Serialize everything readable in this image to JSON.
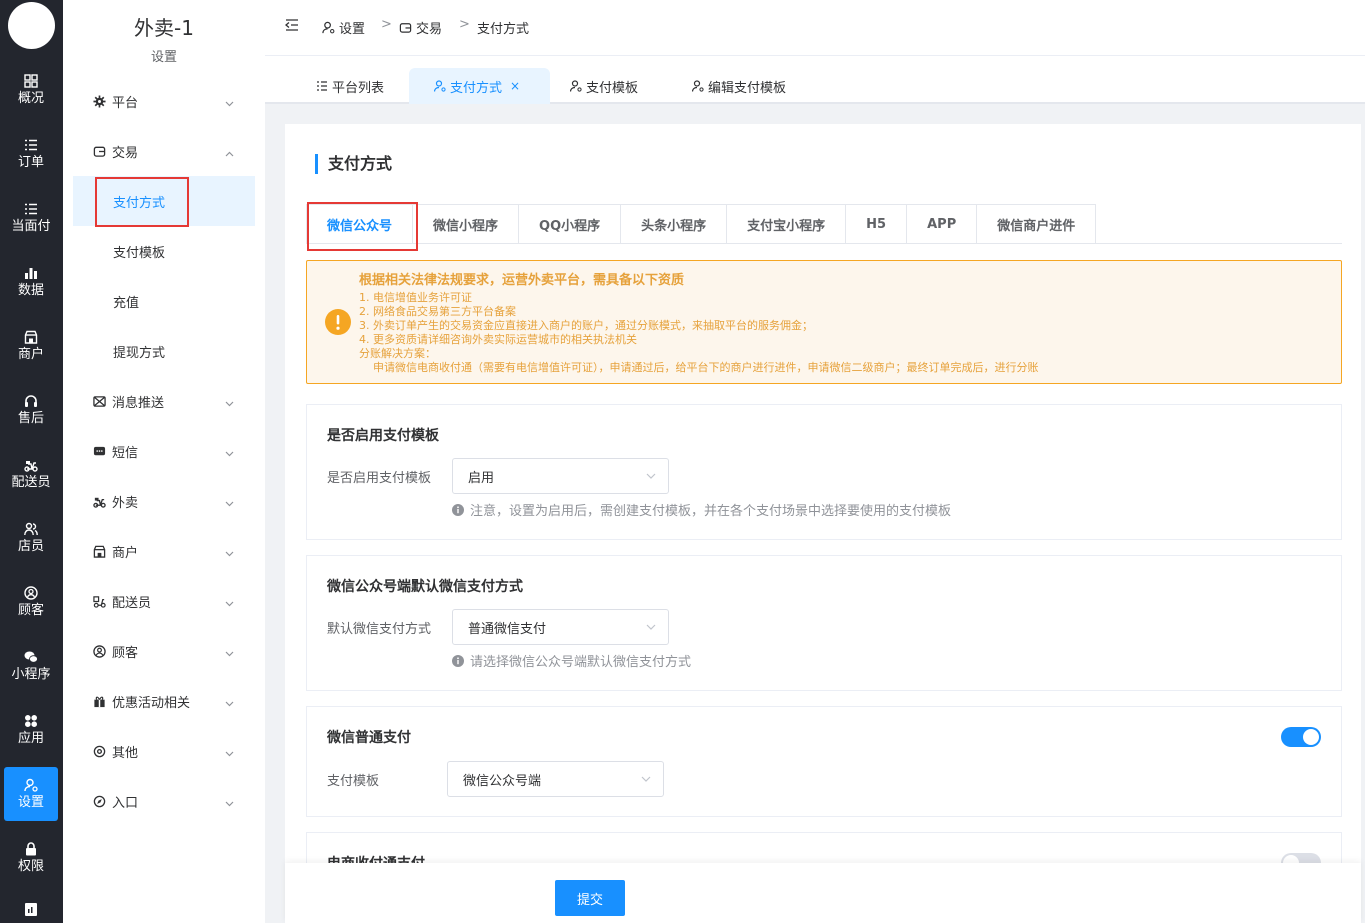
{
  "rail": {
    "items": [
      {
        "label": "概况",
        "icon": "dashboard-icon"
      },
      {
        "label": "订单",
        "icon": "list-icon"
      },
      {
        "label": "当面付",
        "icon": "list-icon"
      },
      {
        "label": "数据",
        "icon": "bar-chart-icon"
      },
      {
        "label": "商户",
        "icon": "shop-icon"
      },
      {
        "label": "售后",
        "icon": "headset-icon"
      },
      {
        "label": "配送员",
        "icon": "scooter-icon"
      },
      {
        "label": "店员",
        "icon": "users-icon"
      },
      {
        "label": "顾客",
        "icon": "user-circle-icon"
      },
      {
        "label": "小程序",
        "icon": "wechat-icon"
      },
      {
        "label": "应用",
        "icon": "apps-icon"
      },
      {
        "label": "设置",
        "icon": "settings-user-icon"
      },
      {
        "label": "权限",
        "icon": "lock-icon"
      }
    ],
    "active_index": 11
  },
  "sidebar": {
    "title": "外卖-1",
    "subtitle": "设置",
    "menu": [
      {
        "label": "平台",
        "icon": "gear-icon",
        "expanded": false
      },
      {
        "label": "交易",
        "icon": "wallet-icon",
        "expanded": true
      },
      {
        "label": "消息推送",
        "icon": "message-icon",
        "expanded": false
      },
      {
        "label": "短信",
        "icon": "sms-icon",
        "expanded": false
      },
      {
        "label": "外卖",
        "icon": "scooter-icon",
        "expanded": false
      },
      {
        "label": "商户",
        "icon": "shop-icon",
        "expanded": false
      },
      {
        "label": "配送员",
        "icon": "courier-icon",
        "expanded": false
      },
      {
        "label": "顾客",
        "icon": "user-circle-icon",
        "expanded": false
      },
      {
        "label": "优惠活动相关",
        "icon": "gift-icon",
        "expanded": false
      },
      {
        "label": "其他",
        "icon": "settings-icon",
        "expanded": false
      },
      {
        "label": "入口",
        "icon": "compass-icon",
        "expanded": false
      }
    ],
    "submenu": [
      {
        "label": "支付方式",
        "active": true
      },
      {
        "label": "支付模板",
        "active": false
      },
      {
        "label": "充值",
        "active": false
      },
      {
        "label": "提现方式",
        "active": false
      }
    ]
  },
  "header": {
    "breadcrumb": [
      "设置",
      "交易",
      "支付方式"
    ]
  },
  "view_tabs": [
    {
      "label": "平台列表",
      "active": false
    },
    {
      "label": "支付方式",
      "active": true,
      "closable": true
    },
    {
      "label": "支付模板",
      "active": false
    },
    {
      "label": "编辑支付模板",
      "active": false
    }
  ],
  "page": {
    "title": "支付方式",
    "platform_tabs": [
      "微信公众号",
      "微信小程序",
      "QQ小程序",
      "头条小程序",
      "支付宝小程序",
      "H5",
      "APP",
      "微信商户进件"
    ],
    "active_platform": 0,
    "alert": {
      "title": "根据相关法律法规要求，运营外卖平台，需具备以下资质",
      "lines": [
        "1. 电信增值业务许可证",
        "2. 网络食品交易第三方平台备案",
        "3. 外卖订单产生的交易资金应直接进入商户的账户，通过分账模式，来抽取平台的服务佣金；",
        "4. 更多资质请详细咨询外卖实际运营城市的相关执法机关",
        "分账解决方案：",
        "    申请微信电商收付通（需要有电信增值许可证），申请通过后，给平台下的商户进行进件，申请微信二级商户；最终订单完成后，进行分账"
      ]
    },
    "template_section": {
      "title": "是否启用支付模板",
      "label": "是否启用支付模板",
      "value": "启用",
      "hint": "注意，设置为启用后，需创建支付模板，并在各个支付场景中选择要使用的支付模板"
    },
    "default_section": {
      "title": "微信公众号端默认微信支付方式",
      "label": "默认微信支付方式",
      "value": "普通微信支付",
      "hint": "请选择微信公众号端默认微信支付方式"
    },
    "normal_pay_section": {
      "title": "微信普通支付",
      "enabled": true,
      "label": "支付模板",
      "value": "微信公众号端"
    },
    "ecommerce_section": {
      "title": "电商收付通支付",
      "enabled": false
    },
    "submit_label": "提交"
  },
  "colors": {
    "primary": "#1890ff",
    "rail_bg": "#23262e",
    "warning": "#e6a23c",
    "highlight_box": "#e53935"
  }
}
